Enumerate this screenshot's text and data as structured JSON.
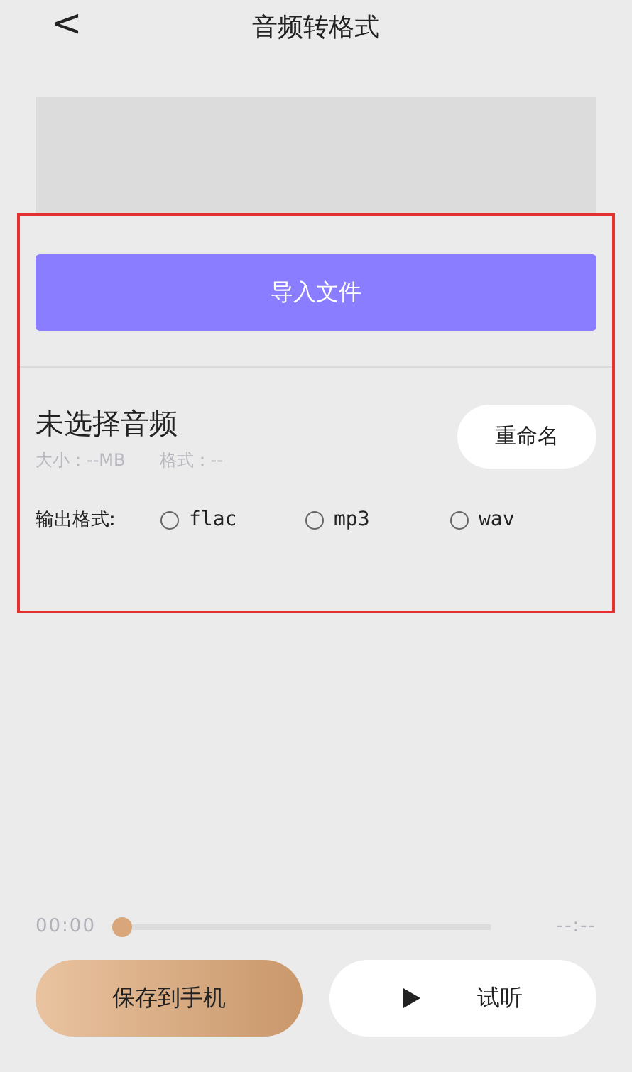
{
  "header": {
    "back": "<",
    "title": "音频转格式"
  },
  "import_button": "导入文件",
  "audio": {
    "name": "未选择音频",
    "size": "大小：--MB",
    "format": "格式：--",
    "rename": "重命名"
  },
  "output": {
    "label": "输出格式:",
    "options": [
      {
        "label": "flac",
        "selected": false
      },
      {
        "label": "mp3",
        "selected": false
      },
      {
        "label": "wav",
        "selected": false
      }
    ]
  },
  "player": {
    "current": "00:00",
    "total": "--:--",
    "level": 0
  },
  "buttons": {
    "save": "保存到手机",
    "listen": "试听"
  }
}
